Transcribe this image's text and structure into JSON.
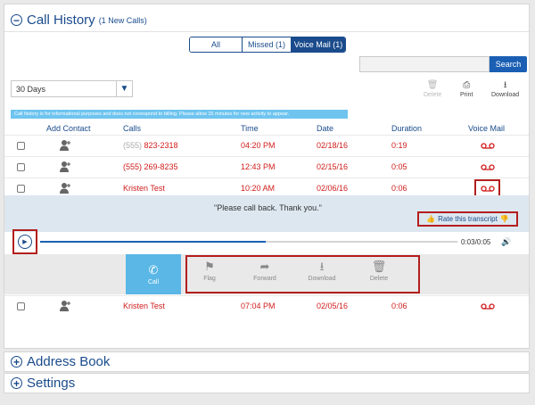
{
  "call_history": {
    "title": "Call History",
    "subtitle": "(1 New Calls)",
    "tabs": [
      {
        "label": "All"
      },
      {
        "label": "Missed (1)"
      },
      {
        "label": "Voice Mail (1)",
        "active": true
      }
    ],
    "search": {
      "placeholder": "",
      "button_label": "Search"
    },
    "range_select": {
      "value": "30 Days"
    },
    "toolbar": {
      "delete": "Delete",
      "print": "Print",
      "download": "Download"
    },
    "info_text": "Call history is for informational purposes and does not correspond to billing. Please allow 15 minutes for new activity to appear.",
    "columns": [
      "Add Contact",
      "Calls",
      "Time",
      "Date",
      "Duration",
      "Voice Mail"
    ],
    "rows": [
      {
        "call_prefix": "(555)",
        "call": "823-2318",
        "time": "04:20 PM",
        "date": "02/18/16",
        "duration": "0:19"
      },
      {
        "call_prefix": "(555)",
        "call": "269-8235",
        "time": "12:43 PM",
        "date": "02/15/16",
        "duration": "0:05"
      },
      {
        "call_prefix": "",
        "call": "Kristen Test",
        "time": "10:20 AM",
        "date": "02/06/16",
        "duration": "0:06"
      },
      {
        "call_prefix": "",
        "call": "Kristen Test",
        "time": "07:04 PM",
        "date": "02/05/16",
        "duration": "0:06"
      }
    ],
    "transcript": {
      "text": "\"Please call back. Thank you.\"",
      "rate_label": "Rate this transcript"
    },
    "player": {
      "time": "0:03/0:05",
      "progress": 0.54
    },
    "actions": {
      "call": "Call",
      "flag": "Flag",
      "forward": "Forward",
      "download": "Download",
      "delete": "Delete"
    }
  },
  "sections": {
    "address_book": "Address Book",
    "settings": "Settings"
  },
  "colors": {
    "brand_blue": "#1a4b8c",
    "accent_blue": "#1a5fb4",
    "missed_red": "#d01c1c",
    "info_bar": "#6ec4ef",
    "call_button": "#5ab7e6",
    "highlight": "#b31e1e"
  },
  "icons": {
    "panel_toggle": "circle-minus-icon",
    "add_contact": "add-person-icon",
    "voicemail": "voicemail-icon",
    "play": "play-icon",
    "volume": "volume-icon"
  }
}
